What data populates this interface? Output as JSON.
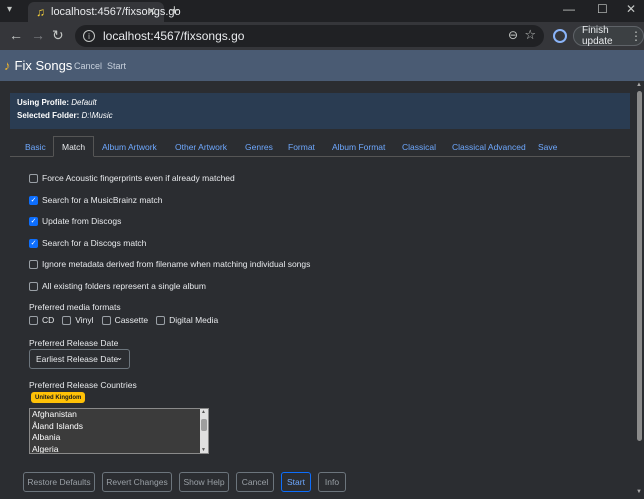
{
  "browser": {
    "tab_title": "localhost:4567/fixsongs.go",
    "url": "localhost:4567/fixsongs.go",
    "update_button": "Finish update"
  },
  "app": {
    "brand": "Fix Songs",
    "nav": {
      "cancel": "Cancel",
      "start": "Start"
    }
  },
  "info": {
    "profile_label": "Using Profile:",
    "profile_value": "Default",
    "folder_label": "Selected Folder:",
    "folder_value": "D:\\Music"
  },
  "tabs": [
    "Basic",
    "Match",
    "Album Artwork",
    "Other Artwork",
    "Genres",
    "Format",
    "Album Format",
    "Classical",
    "Classical Advanced",
    "Save"
  ],
  "active_tab": "Match",
  "options": [
    {
      "label": "Force Acoustic fingerprints even if already matched",
      "checked": false
    },
    {
      "label": "Search for a MusicBrainz match",
      "checked": true
    },
    {
      "label": "Update from Discogs",
      "checked": true
    },
    {
      "label": "Search for a Discogs match",
      "checked": true
    },
    {
      "label": "Ignore metadata derived from filename when matching individual songs",
      "checked": false
    },
    {
      "label": "All existing folders represent a single album",
      "checked": false
    }
  ],
  "media_formats": {
    "label": "Preferred media formats",
    "items": [
      {
        "label": "CD",
        "checked": false
      },
      {
        "label": "Vinyl",
        "checked": false
      },
      {
        "label": "Cassette",
        "checked": false
      },
      {
        "label": "Digital Media",
        "checked": false
      }
    ]
  },
  "release_date": {
    "label": "Preferred Release Date",
    "value": "Earliest Release Date"
  },
  "release_countries": {
    "label": "Preferred Release Countries",
    "selected_badge": "United Kingdom",
    "options": [
      "Afghanistan",
      "Åland Islands",
      "Albania",
      "Algeria"
    ]
  },
  "buttons": {
    "restore": "Restore Defaults",
    "revert": "Revert Changes",
    "help": "Show Help",
    "cancel": "Cancel",
    "start": "Start",
    "info": "Info"
  }
}
